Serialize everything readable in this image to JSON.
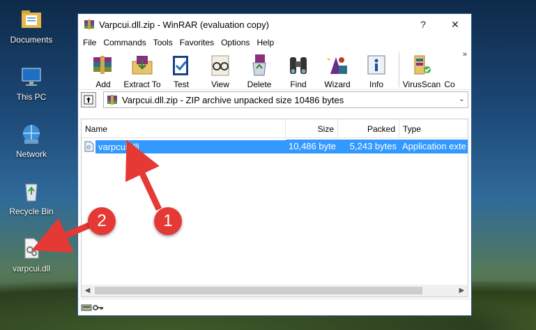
{
  "desktop": {
    "icons": [
      {
        "label": "Documents",
        "icon": "folder-documents-icon"
      },
      {
        "label": "This PC",
        "icon": "computer-icon"
      },
      {
        "label": "Network",
        "icon": "network-icon"
      },
      {
        "label": "Recycle Bin",
        "icon": "recycle-bin-icon"
      },
      {
        "label": "varpcui.dll",
        "icon": "dll-file-icon"
      }
    ]
  },
  "window": {
    "title": "Varpcui.dll.zip - WinRAR (evaluation copy)",
    "help_btn": "?",
    "close_btn": "✕"
  },
  "menu": [
    "File",
    "Commands",
    "Tools",
    "Favorites",
    "Options",
    "Help"
  ],
  "toolbar": {
    "buttons": [
      {
        "label": "Add",
        "icon": "add-archive-icon"
      },
      {
        "label": "Extract To",
        "icon": "extract-folder-icon"
      },
      {
        "label": "Test",
        "icon": "test-check-icon"
      },
      {
        "label": "View",
        "icon": "view-glasses-icon"
      },
      {
        "label": "Delete",
        "icon": "delete-recycle-icon"
      },
      {
        "label": "Find",
        "icon": "find-binoculars-icon"
      },
      {
        "label": "Wizard",
        "icon": "wizard-icon"
      },
      {
        "label": "Info",
        "icon": "info-icon"
      },
      {
        "label": "VirusScan",
        "icon": "virusscan-icon"
      },
      {
        "label": "Co",
        "icon": "comment-icon"
      }
    ],
    "more": "»"
  },
  "address": {
    "text": "Varpcui.dll.zip - ZIP archive unpacked size 10486 bytes"
  },
  "list": {
    "columns": [
      "Name",
      "Size",
      "Packed",
      "Type"
    ],
    "rows": [
      {
        "name": "varpcui.dll",
        "size": "10,486 byte",
        "packed": "5,243 bytes",
        "type": "Application exte"
      }
    ]
  },
  "annotations": {
    "badge1": "1",
    "badge2": "2"
  },
  "colors": {
    "selection": "#3399ff",
    "badge": "#e53935"
  }
}
